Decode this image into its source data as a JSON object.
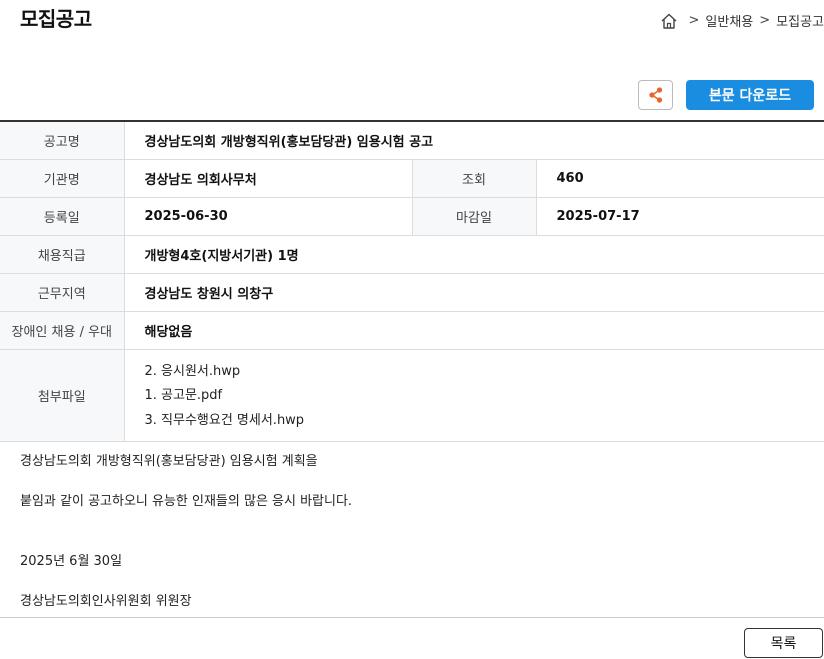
{
  "page_title": "모집공고",
  "breadcrumb": {
    "home_icon": "home-icon",
    "items": [
      "일반채용",
      "모집공고"
    ],
    "separator": ">"
  },
  "actions": {
    "share_icon": "share-icon",
    "download_label": "본문 다운로드"
  },
  "info": {
    "title_label": "공고명",
    "title_value": "경상남도의회 개방형직위(홍보담당관) 임용시험 공고",
    "agency_label": "기관명",
    "agency_value": "경상남도 의회사무처",
    "views_label": "조회",
    "views_value": "460",
    "reg_label": "등록일",
    "reg_value": "2025-06-30",
    "deadline_label": "마감일",
    "deadline_value": "2025-07-17",
    "grade_label": "채용직급",
    "grade_value": "개방형4호(지방서기관) 1명",
    "region_label": "근무지역",
    "region_value": "경상남도 창원시 의창구",
    "disability_label": "장애인 채용 / 우대",
    "disability_value": "해당없음",
    "files_label": "첨부파일",
    "files": [
      "2. 응시원서.hwp",
      "1. 공고문.pdf",
      "3. 직무수행요건 명세서.hwp"
    ]
  },
  "body": {
    "line1": "경상남도의회 개방형직위(홍보담당관) 임용시험 계획을",
    "line2": "붙임과 같이 공고하오니 유능한 인재들의 많은 응시 바랍니다.",
    "date": "2025년 6월 30일",
    "signature": "경상남도의회인사위원회 위원장"
  },
  "list_button": "목록",
  "colors": {
    "accent": "#1a8de0",
    "share_icon": "#e8642c"
  }
}
